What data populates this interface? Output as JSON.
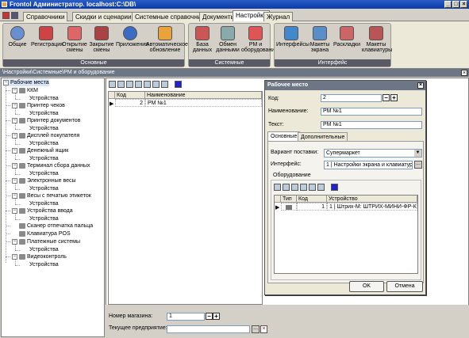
{
  "window": {
    "title": "Frontol Администратор. localhost:C:\\DB\\"
  },
  "menu_tabs": [
    "Справочники",
    "Скидки и сценарии",
    "Системные справочники",
    "Документы",
    "Настройки",
    "Журнал"
  ],
  "ribbon": {
    "groups": [
      {
        "label": "Основные",
        "buttons": [
          {
            "label": "Общие",
            "icon": "settings-icon"
          },
          {
            "label": "Регистрация",
            "icon": "registration-icon"
          },
          {
            "label": "Открытие смены",
            "icon": "open-shift-icon"
          },
          {
            "label": "Закрытие смены",
            "icon": "close-shift-icon"
          },
          {
            "label": "Приложения",
            "icon": "applications-icon"
          },
          {
            "label": "Автоматическое обновление",
            "icon": "auto-update-icon"
          }
        ]
      },
      {
        "label": "Системные",
        "buttons": [
          {
            "label": "База данных",
            "icon": "database-icon"
          },
          {
            "label": "Обмен данными",
            "icon": "data-exchange-icon"
          },
          {
            "label": "РМ и оборудование",
            "icon": "workplace-equipment-icon"
          }
        ]
      },
      {
        "label": "Интерфейс",
        "buttons": [
          {
            "label": "Интерфейсы",
            "icon": "interfaces-icon"
          },
          {
            "label": "Макеты экрана",
            "icon": "screen-layouts-icon"
          },
          {
            "label": "Раскладки",
            "icon": "layouts-icon"
          },
          {
            "label": "Макеты клавиатуры",
            "icon": "keyboard-layouts-icon"
          }
        ]
      }
    ]
  },
  "path_bar": "\\Настройки\\Системные\\РМ и оборудование",
  "tree": {
    "root": "Рабочие места",
    "items": [
      {
        "label": "ККМ",
        "child": "Устройства"
      },
      {
        "label": "Принтер чеков",
        "child": "Устройства"
      },
      {
        "label": "Принтер документов",
        "child": "Устройства"
      },
      {
        "label": "Дисплей покупателя",
        "child": "Устройства"
      },
      {
        "label": "Денежный ящик",
        "child": "Устройства"
      },
      {
        "label": "Терминал сбора данных",
        "child": "Устройства"
      },
      {
        "label": "Электронные весы",
        "child": "Устройства"
      },
      {
        "label": "Весы с печатью этикеток",
        "child": "Устройства"
      },
      {
        "label": "Устройства ввода",
        "child": "Устройства"
      },
      {
        "label": "Сканер отпечатка пальца",
        "child": ""
      },
      {
        "label": "Клавиатура POS",
        "child": ""
      },
      {
        "label": "Платежные системы",
        "child": "Устройства"
      },
      {
        "label": "Видеоконтроль",
        "child": "Устройства"
      }
    ]
  },
  "main_grid": {
    "columns": [
      "Код",
      "Наименование"
    ],
    "rows": [
      {
        "code": "2",
        "name": "РМ №1"
      }
    ]
  },
  "bottom": {
    "store_label": "Номер магазина:",
    "store_value": "1",
    "company_label": "Текущее предприятие:",
    "company_value": ""
  },
  "dialog": {
    "title": "Рабочее место",
    "code_label": "Код:",
    "code_value": "2",
    "name_label": "Наименование:",
    "name_value": "РМ №1",
    "text_label": "Текст:",
    "text_value": "РМ №1",
    "tabs": [
      "Основные",
      "Дополнительные"
    ],
    "delivery_label": "Вариант поставки:",
    "delivery_value": "Супермаркет",
    "interface_label": "Интерфейс:",
    "interface_value": "1 | Настройки экрана и клавиатуры",
    "equipment_label": "Оборудование",
    "eq_columns": [
      "Тип",
      "Код",
      "Устройство"
    ],
    "eq_rows": [
      {
        "code": "1",
        "device": "1 | Штрих-М: ШТРИХ-МИНИ-ФР-К"
      }
    ],
    "ok": "OK",
    "cancel": "Отмена"
  }
}
